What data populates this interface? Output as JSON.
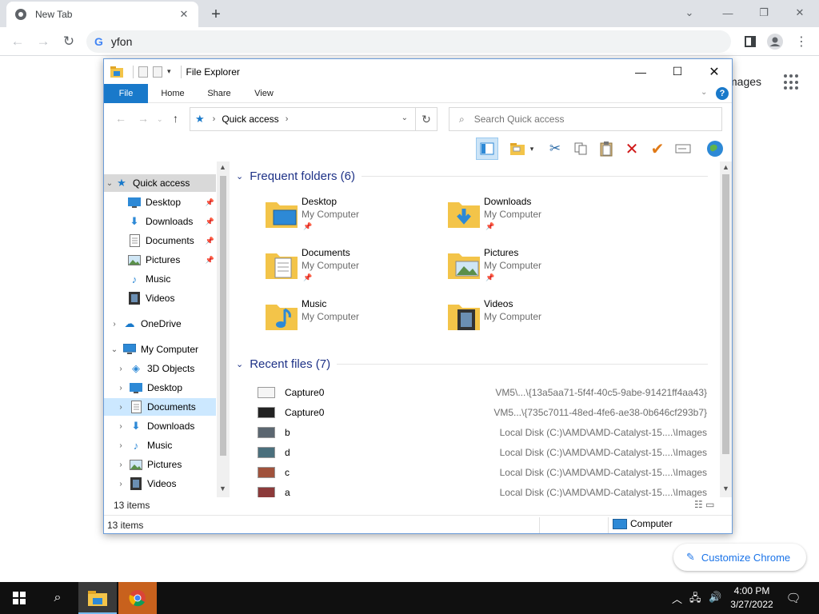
{
  "browser": {
    "tab_title": "New Tab",
    "omnibox_text": "yfon",
    "ntp_images_link": "mages",
    "customize_label": "Customize Chrome"
  },
  "explorer": {
    "window_title": "File Explorer",
    "ribbon_tabs": [
      "File",
      "Home",
      "Share",
      "View"
    ],
    "breadcrumb": "Quick access",
    "search_placeholder": "Search Quick access",
    "nav": {
      "quick_access": "Quick access",
      "qa_items": [
        "Desktop",
        "Downloads",
        "Documents",
        "Pictures",
        "Music",
        "Videos"
      ],
      "onedrive": "OneDrive",
      "my_computer": "My Computer",
      "pc_items": [
        "3D Objects",
        "Desktop",
        "Documents",
        "Downloads",
        "Music",
        "Pictures",
        "Videos"
      ]
    },
    "frequent_header": "Frequent folders (6)",
    "frequent": [
      {
        "name": "Desktop",
        "location": "My Computer",
        "pinned": true
      },
      {
        "name": "Downloads",
        "location": "My Computer",
        "pinned": true
      },
      {
        "name": "Documents",
        "location": "My Computer",
        "pinned": true
      },
      {
        "name": "Pictures",
        "location": "My Computer",
        "pinned": true
      },
      {
        "name": "Music",
        "location": "My Computer",
        "pinned": false
      },
      {
        "name": "Videos",
        "location": "My Computer",
        "pinned": false
      }
    ],
    "recent_header": "Recent files (7)",
    "recent": [
      {
        "name": "Capture0",
        "path": "VM5\\...\\{13a5aa71-5f4f-40c5-9abe-91421ff4aa43}"
      },
      {
        "name": "Capture0",
        "path": "VM5...\\{735c7011-48ed-4fe6-ae38-0b646cf293b7}"
      },
      {
        "name": "b",
        "path": "Local Disk (C:)\\AMD\\AMD-Catalyst-15....\\Images"
      },
      {
        "name": "d",
        "path": "Local Disk (C:)\\AMD\\AMD-Catalyst-15....\\Images"
      },
      {
        "name": "c",
        "path": "Local Disk (C:)\\AMD\\AMD-Catalyst-15....\\Images"
      },
      {
        "name": "a",
        "path": "Local Disk (C:)\\AMD\\AMD-Catalyst-15....\\Images"
      }
    ],
    "inner_status": "13 items",
    "status_items": "13 items",
    "status_location": "Computer"
  },
  "taskbar": {
    "time": "4:00 PM",
    "date": "3/27/2022"
  },
  "colors": {
    "accent": "#1979ca",
    "group_header": "#1e3287",
    "selection": "#cce8ff",
    "taskbar": "#101010"
  }
}
